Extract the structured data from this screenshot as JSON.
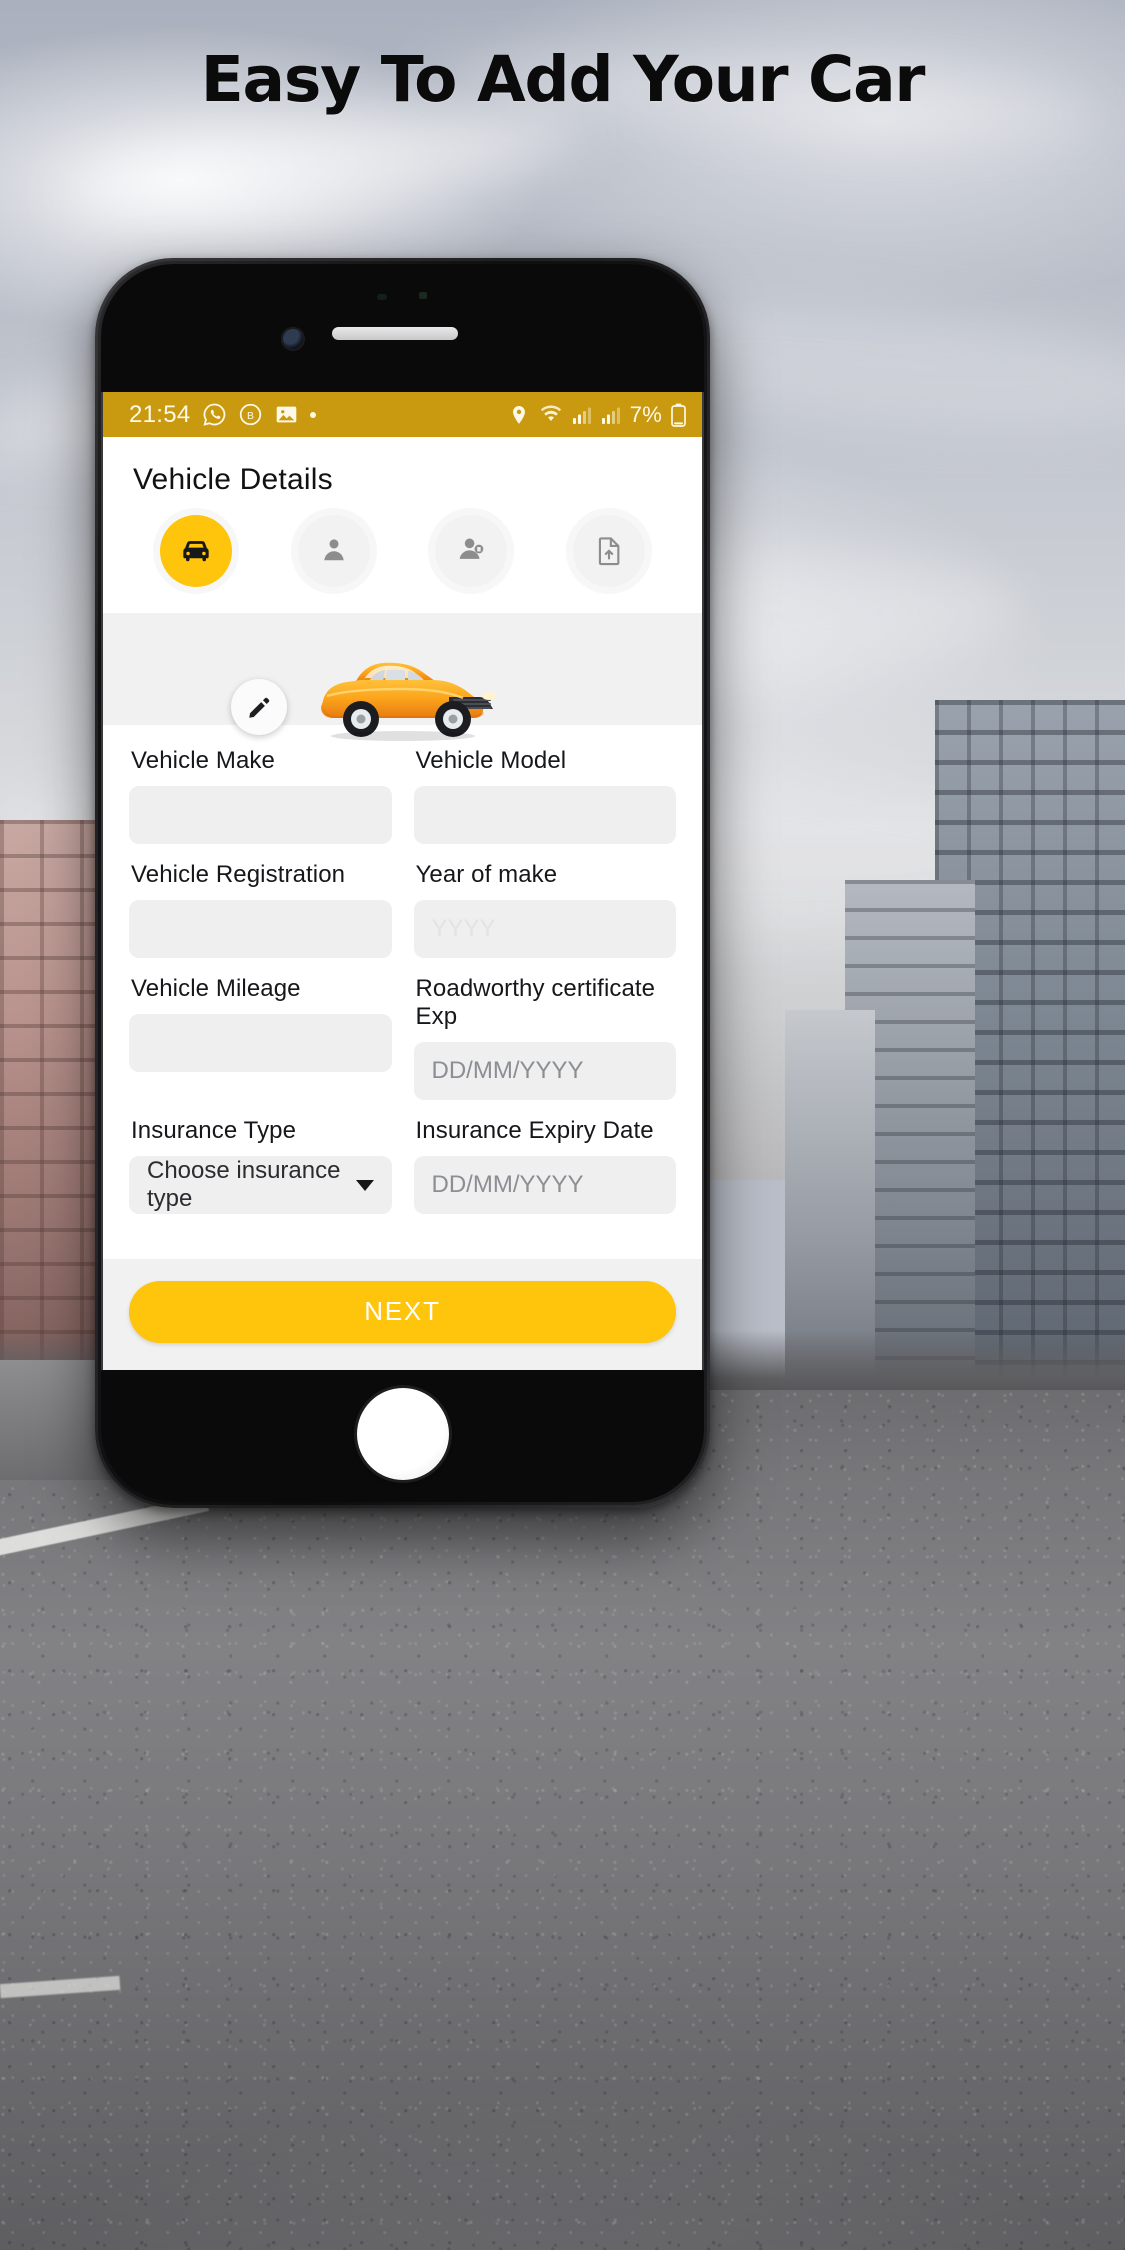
{
  "headline": "Easy To Add Your Car",
  "phone": {
    "status_bar": {
      "time": "21:54",
      "left_icons": [
        "whatsapp-icon",
        "b-circle-icon",
        "image-icon",
        "dot-icon"
      ],
      "right_icons": [
        "location-icon",
        "wifi-icon",
        "signal-icon",
        "signal-icon-2"
      ],
      "battery_percent": "7%",
      "bar_color": "#C99A10"
    },
    "screen": {
      "title": "Vehicle Details",
      "stepper": [
        {
          "name": "vehicle",
          "icon": "car-icon",
          "active": true
        },
        {
          "name": "driver",
          "icon": "person-icon",
          "active": false
        },
        {
          "name": "owner",
          "icon": "person-badge-icon",
          "active": false
        },
        {
          "name": "documents",
          "icon": "upload-document-icon",
          "active": false
        }
      ],
      "hero": {
        "image": "orange-car-image",
        "edit_icon": "pencil-icon"
      },
      "fields": [
        {
          "label": "Vehicle Make",
          "value": "",
          "placeholder": "",
          "type": "text",
          "style": "empty"
        },
        {
          "label": "Vehicle Model",
          "value": "",
          "placeholder": "",
          "type": "text",
          "style": "empty"
        },
        {
          "label": "Vehicle Registration",
          "value": "",
          "placeholder": "",
          "type": "text",
          "style": "empty"
        },
        {
          "label": "Year of make",
          "value": "",
          "placeholder": "YYYY",
          "type": "text",
          "style": "faint"
        },
        {
          "label": "Vehicle Mileage",
          "value": "",
          "placeholder": "",
          "type": "text",
          "style": "empty"
        },
        {
          "label": "Roadworthy certificate Exp",
          "value": "",
          "placeholder": "DD/MM/YYYY",
          "type": "date",
          "style": "normal"
        },
        {
          "label": "Insurance Type",
          "value": "Choose insurance type",
          "placeholder": "",
          "type": "select",
          "style": "normal"
        },
        {
          "label": "Insurance Expiry Date",
          "value": "",
          "placeholder": "DD/MM/YYYY",
          "type": "date",
          "style": "normal"
        }
      ],
      "next_button": "NEXT",
      "accent_color": "#FFC40C"
    }
  }
}
